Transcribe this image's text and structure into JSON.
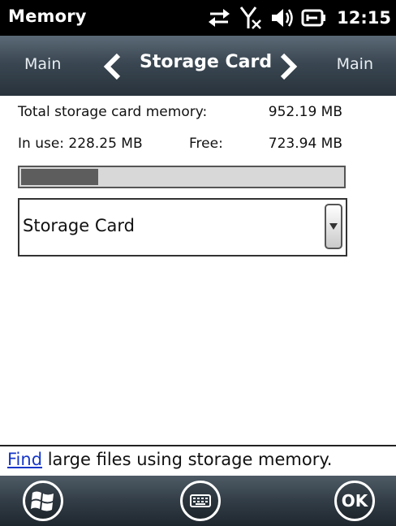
{
  "statusbar": {
    "app_title": "Memory",
    "time": "12:15",
    "icons": [
      "sync-arrows-icon",
      "no-signal-icon",
      "volume-icon",
      "battery-charging-icon"
    ]
  },
  "tabs": {
    "left": "Main",
    "current": "Storage Card",
    "right": "Main"
  },
  "memory": {
    "total_label": "Total storage card memory:",
    "total_value": "952.19 MB",
    "inuse_label": "In use:",
    "inuse_value": "228.25 MB",
    "free_label": "Free:",
    "free_value": "723.94 MB",
    "usage_fraction": 0.24
  },
  "selector": {
    "selected": "Storage Card"
  },
  "footer": {
    "link_text": "Find",
    "rest_text": " large files using storage memory."
  },
  "softkeys": {
    "start_icon": "windows-logo-icon",
    "keyboard_icon": "keyboard-icon",
    "ok_label": "OK"
  },
  "colors": {
    "link": "#1536c9",
    "usage_fill": "#5d5d5d",
    "usage_track": "#d8d8d8"
  }
}
